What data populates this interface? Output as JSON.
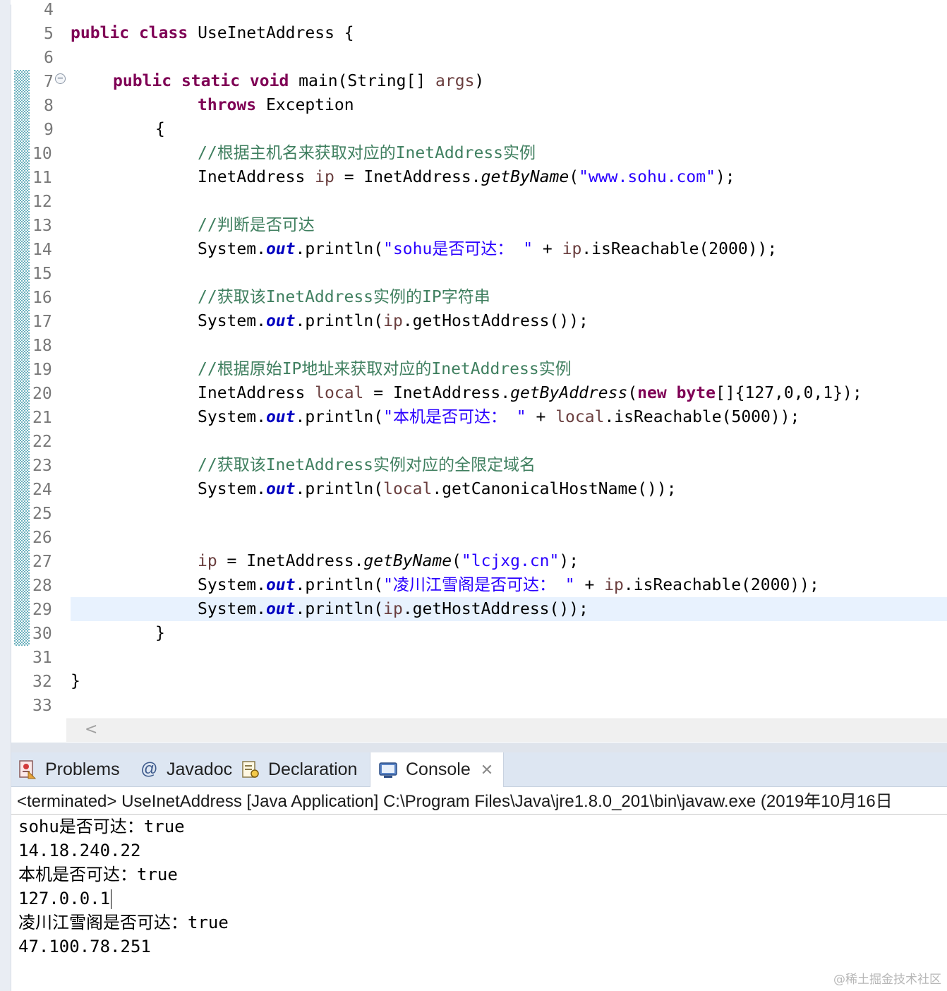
{
  "editor": {
    "line_numbers": [
      "4",
      "5",
      "6",
      "7",
      "8",
      "9",
      "10",
      "11",
      "12",
      "13",
      "14",
      "15",
      "16",
      "17",
      "18",
      "19",
      "20",
      "21",
      "22",
      "23",
      "24",
      "25",
      "26",
      "27",
      "28",
      "29",
      "30",
      "31",
      "32",
      "33"
    ],
    "lines": {
      "l5": {
        "kw1": "public",
        "kw2": "class",
        "rest": "UseInetAddress {"
      },
      "l7": {
        "kw1": "public",
        "kw2": "static",
        "kw3": "void",
        "rest": "main(String[] ",
        "param": "args",
        "tail": ")"
      },
      "l8": {
        "kw": "throws",
        "rest": "Exception"
      },
      "l9": {
        "text": "{"
      },
      "l10": {
        "comment": "//根据主机名来获取对应的InetAddress实例"
      },
      "l11": {
        "a": "InetAddress ",
        "var": "ip",
        "b": " = InetAddress.",
        "method": "getByName",
        "c": "(",
        "str": "\"www.sohu.com\"",
        "d": ");"
      },
      "l13": {
        "comment": "//判断是否可达"
      },
      "l14": {
        "a": "System.",
        "fld": "out",
        "b": ".println(",
        "str": "\"sohu是否可达： \"",
        "c": " + ",
        "var": "ip",
        "d": ".isReachable(2000));"
      },
      "l16": {
        "comment": "//获取该InetAddress实例的IP字符串"
      },
      "l17": {
        "a": "System.",
        "fld": "out",
        "b": ".println(",
        "var": "ip",
        "d": ".getHostAddress());"
      },
      "l19": {
        "comment": "//根据原始IP地址来获取对应的InetAddress实例"
      },
      "l20": {
        "a": "InetAddress ",
        "var": "local",
        "b": " = InetAddress.",
        "method": "getByAddress",
        "c": "(",
        "kw1": "new",
        "sp": " ",
        "kw2": "byte",
        "d": "[]{127,0,0,1});"
      },
      "l21": {
        "a": "System.",
        "fld": "out",
        "b": ".println(",
        "str": "\"本机是否可达： \"",
        "c": " + ",
        "var": "local",
        "d": ".isReachable(5000));"
      },
      "l23": {
        "comment": "//获取该InetAddress实例对应的全限定域名"
      },
      "l24": {
        "a": "System.",
        "fld": "out",
        "b": ".println(",
        "var": "local",
        "d": ".getCanonicalHostName());"
      },
      "l27": {
        "var": "ip",
        "b": " = InetAddress.",
        "method": "getByName",
        "c": "(",
        "str": "\"lcjxg.cn\"",
        "d": ");"
      },
      "l28": {
        "a": "System.",
        "fld": "out",
        "b": ".println(",
        "str": "\"凌川江雪阁是否可达： \"",
        "c": " + ",
        "var": "ip",
        "d": ".isReachable(2000));"
      },
      "l29": {
        "a": "System.",
        "fld": "out",
        "b": ".println(",
        "var": "ip",
        "d": ".getHostAddress());"
      },
      "l30": {
        "text": "}"
      },
      "l32": {
        "text": "}"
      }
    },
    "scroll_left_glyph": "<"
  },
  "views": {
    "tabs": [
      {
        "label": "Problems"
      },
      {
        "label": "Javadoc",
        "icon_glyph": "@"
      },
      {
        "label": "Declaration"
      },
      {
        "label": "Console"
      }
    ],
    "close_glyph": "✕"
  },
  "console": {
    "terminated": "<terminated> UseInetAddress [Java Application] C:\\Program Files\\Java\\jre1.8.0_201\\bin\\javaw.exe (2019年10月16日",
    "output": [
      "sohu是否可达：true",
      "14.18.240.22",
      "本机是否可达：true",
      "127.0.0.1",
      "凌川江雪阁是否可达：true",
      "47.100.78.251"
    ]
  },
  "watermark": "@稀土掘金技术社区",
  "colors": {
    "keyword": "#7f0055",
    "comment": "#3f7f5f",
    "string": "#2a00ff",
    "static_field": "#0000c0",
    "local_variable": "#6a3e3e",
    "current_line": "#e8f2fe",
    "tab_bar": "#dde6f2"
  }
}
